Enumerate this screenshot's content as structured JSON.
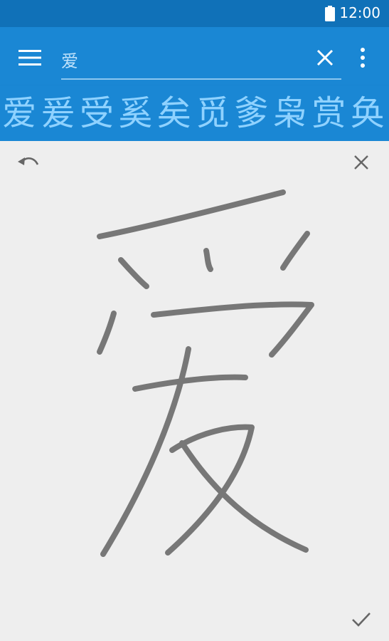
{
  "status_bar": {
    "time": "12:00",
    "battery_icon": "battery-full-icon"
  },
  "app_bar": {
    "menu_icon": "hamburger-menu-icon",
    "search_text": "爱",
    "clear_icon": "close-icon",
    "overflow_icon": "more-vert-icon"
  },
  "candidates": [
    "爱",
    "爰",
    "受",
    "奚",
    "矣",
    "觅",
    "爹",
    "枭",
    "赏",
    "奂"
  ],
  "canvas": {
    "undo_icon": "undo-icon",
    "close_icon": "close-icon",
    "confirm_icon": "check-icon",
    "ink_color": "#777777"
  },
  "colors": {
    "status_bar": "#1071b8",
    "app_bar": "#1a87d4",
    "candidate_text": "#8fd2ff",
    "canvas_bg": "#eeeeee"
  }
}
